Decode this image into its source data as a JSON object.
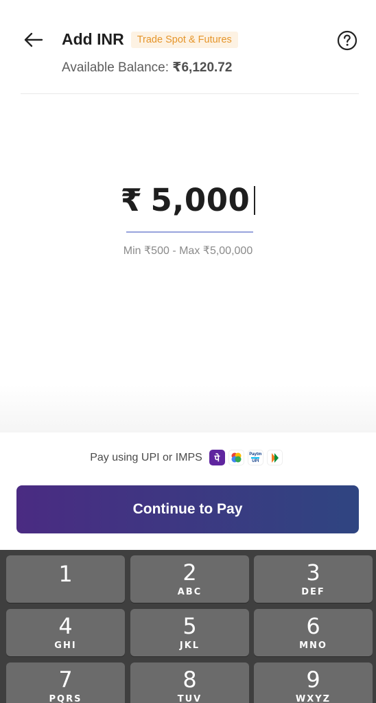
{
  "header": {
    "title": "Add INR",
    "badge": "Trade Spot & Futures",
    "balance_label": "Available Balance: ",
    "balance_value": "₹6,120.72"
  },
  "amount": {
    "currency_symbol": "₹",
    "value": "5,000",
    "limits": "Min ₹500 - Max ₹5,00,000"
  },
  "payment": {
    "pay_using": "Pay using UPI or IMPS",
    "apps": [
      "phonepe-icon",
      "google-pay-icon",
      "paytm-icon",
      "bhim-icon"
    ],
    "phonepe_glyph": "पे",
    "paytm_text_top": "Paytm",
    "paytm_text_bottom": "UPI",
    "continue_label": "Continue to Pay"
  },
  "keypad": {
    "keys": [
      {
        "num": "1",
        "letters": ""
      },
      {
        "num": "2",
        "letters": "ABC"
      },
      {
        "num": "3",
        "letters": "DEF"
      },
      {
        "num": "4",
        "letters": "GHI"
      },
      {
        "num": "5",
        "letters": "JKL"
      },
      {
        "num": "6",
        "letters": "MNO"
      },
      {
        "num": "7",
        "letters": "PQRS"
      },
      {
        "num": "8",
        "letters": "TUV"
      },
      {
        "num": "9",
        "letters": "WXYZ"
      }
    ]
  },
  "colors": {
    "badge_bg": "#fdf2e3",
    "badge_text": "#e5952a",
    "button_gradient_start": "#4a2b82",
    "button_gradient_end": "#2f4581",
    "underline": "#97a3dc",
    "keypad_bg": "#3f3f3f",
    "key_bg": "#6b6b6b"
  }
}
